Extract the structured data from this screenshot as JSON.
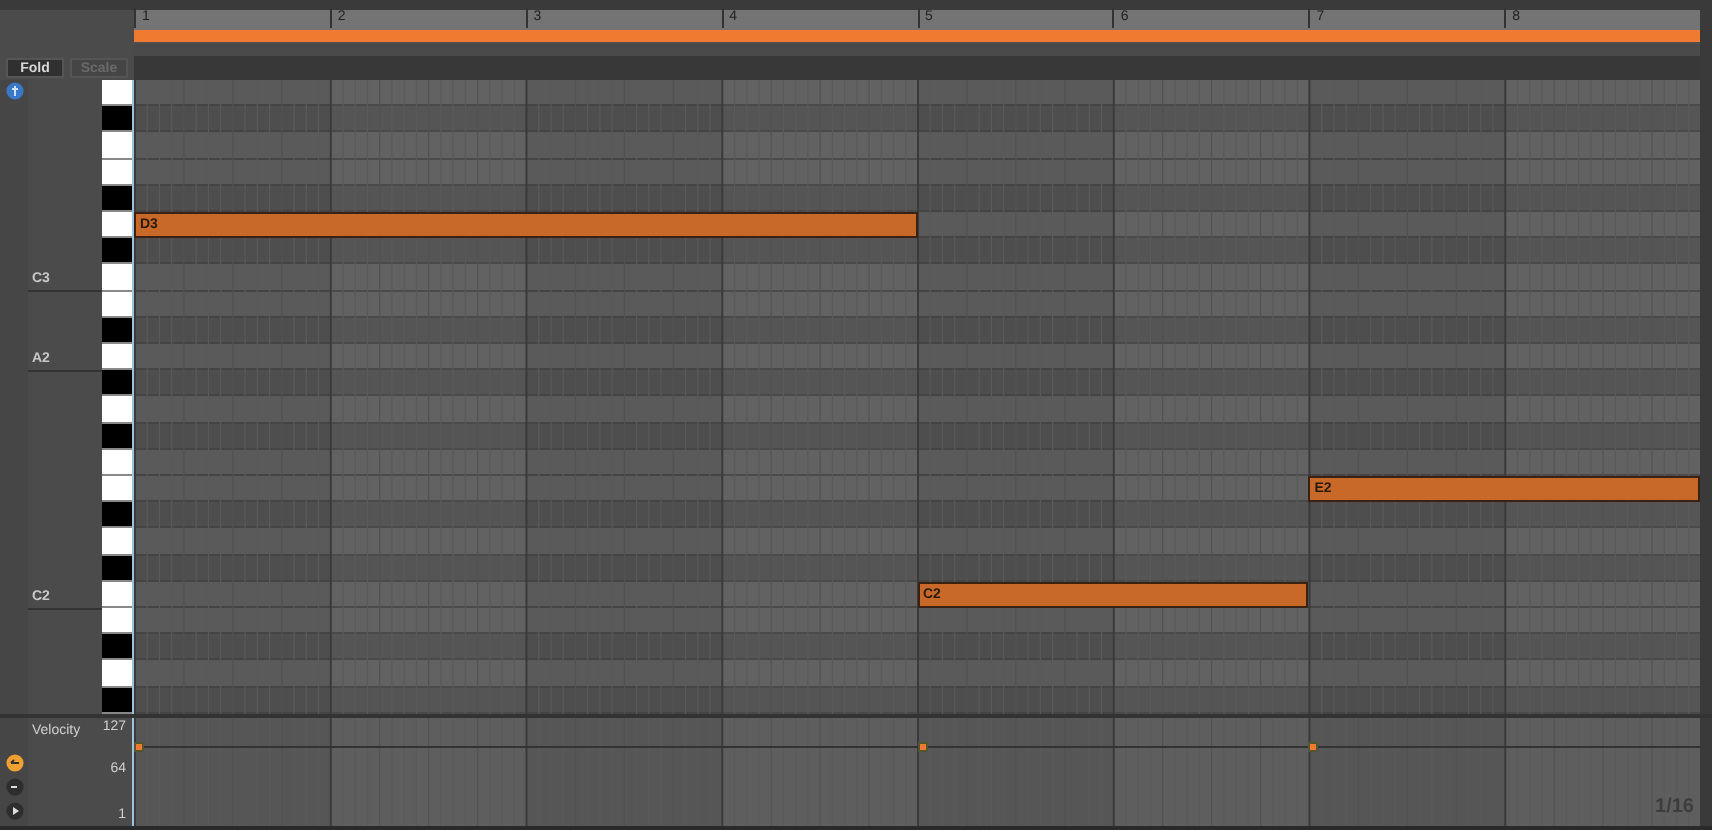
{
  "ruler": {
    "bars": [
      "1",
      "2",
      "3",
      "4",
      "5",
      "6",
      "7",
      "8"
    ]
  },
  "buttons": [
    {
      "label": "Fold",
      "disabled": false
    },
    {
      "label": "Scale",
      "disabled": true
    }
  ],
  "keys": [
    {
      "black": false
    },
    {
      "black": true
    },
    {
      "black": false
    },
    {
      "black": false
    },
    {
      "black": true
    },
    {
      "black": false,
      "notes": [
        {
          "label": "D3"
        }
      ]
    },
    {
      "black": true
    },
    {
      "black": false,
      "label": "C3"
    },
    {
      "black": false
    },
    {
      "black": true
    },
    {
      "black": false,
      "label": "A2"
    },
    {
      "black": true
    },
    {
      "black": false
    },
    {
      "black": true
    },
    {
      "black": false
    },
    {
      "black": false,
      "notes": [
        {
          "label": "E2"
        }
      ]
    },
    {
      "black": true
    },
    {
      "black": false
    },
    {
      "black": true
    },
    {
      "black": false,
      "label": "C2",
      "notes": [
        {
          "label": "C2"
        }
      ]
    },
    {
      "black": false
    },
    {
      "black": true
    },
    {
      "black": false
    },
    {
      "black": true
    }
  ],
  "velocity": {
    "title": "Velocity",
    "ticks": [
      "127",
      "64",
      "1"
    ]
  },
  "grid": "1/16"
}
